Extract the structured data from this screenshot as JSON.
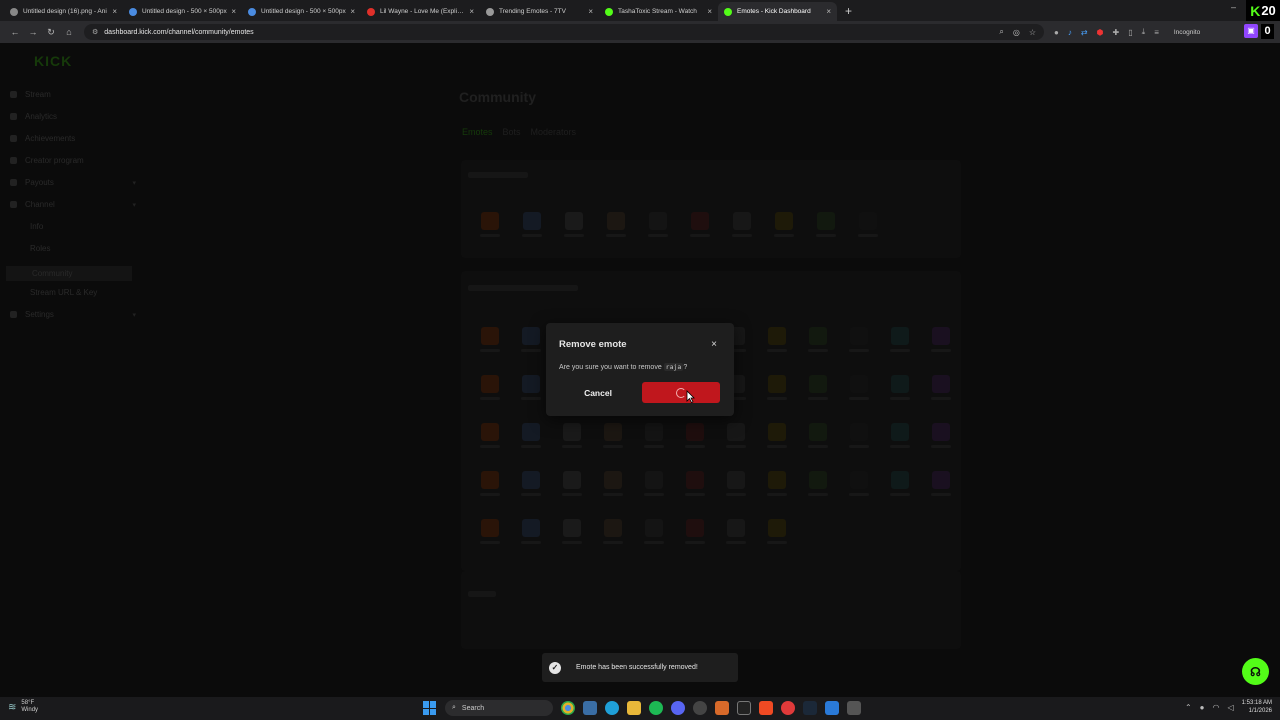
{
  "browser": {
    "tabs": [
      {
        "title": "Untitled design (16).png - Ani",
        "favicon_color": "#888888"
      },
      {
        "title": "Untitled design - 500 × 500px",
        "favicon_color": "#4a8be0"
      },
      {
        "title": "Untitled design - 500 × 500px",
        "favicon_color": "#4a8be0"
      },
      {
        "title": "Lil Wayne - Love Me (Explicit V",
        "favicon_color": "#e0302a"
      },
      {
        "title": "Trending Emotes - 7TV",
        "favicon_color": "#999999"
      },
      {
        "title": "TashaToxic Stream - Watch",
        "favicon_color": "#53fc18"
      },
      {
        "title": "Emotes - Kick Dashboard",
        "favicon_color": "#53fc18",
        "active": true
      }
    ],
    "new_tab_label": "+",
    "address": "dashboard.kick.com/channel/community/emotes",
    "incognito_label": "Incognito",
    "corner_badge_number": "20",
    "extension_badge": "0"
  },
  "page": {
    "logo_text": "KICK",
    "title": "Community",
    "tabs": [
      "Emotes",
      "Bots",
      "Moderators"
    ],
    "sidebar_items": [
      "Stream",
      "Analytics",
      "Achievements",
      "Creator program",
      "Payouts",
      "Channel",
      "Info",
      "Roles",
      "Community",
      "Stream URL & Key",
      "Settings"
    ]
  },
  "modal": {
    "title": "Remove emote",
    "close_label": "×",
    "message_prefix": "Are you sure you want to remove",
    "emote_name": "raja",
    "message_suffix": "?",
    "cancel_label": "Cancel",
    "remove_state": "loading"
  },
  "toast": {
    "message": "Emote has been successfully removed!"
  },
  "taskbar": {
    "temperature": "58°F",
    "weather_desc": "Windy",
    "search_label": "Search",
    "time": "1:53:18 AM",
    "date": "1/1/2026"
  },
  "colors": {
    "kick_green": "#53fc18",
    "danger": "#c0171d"
  }
}
